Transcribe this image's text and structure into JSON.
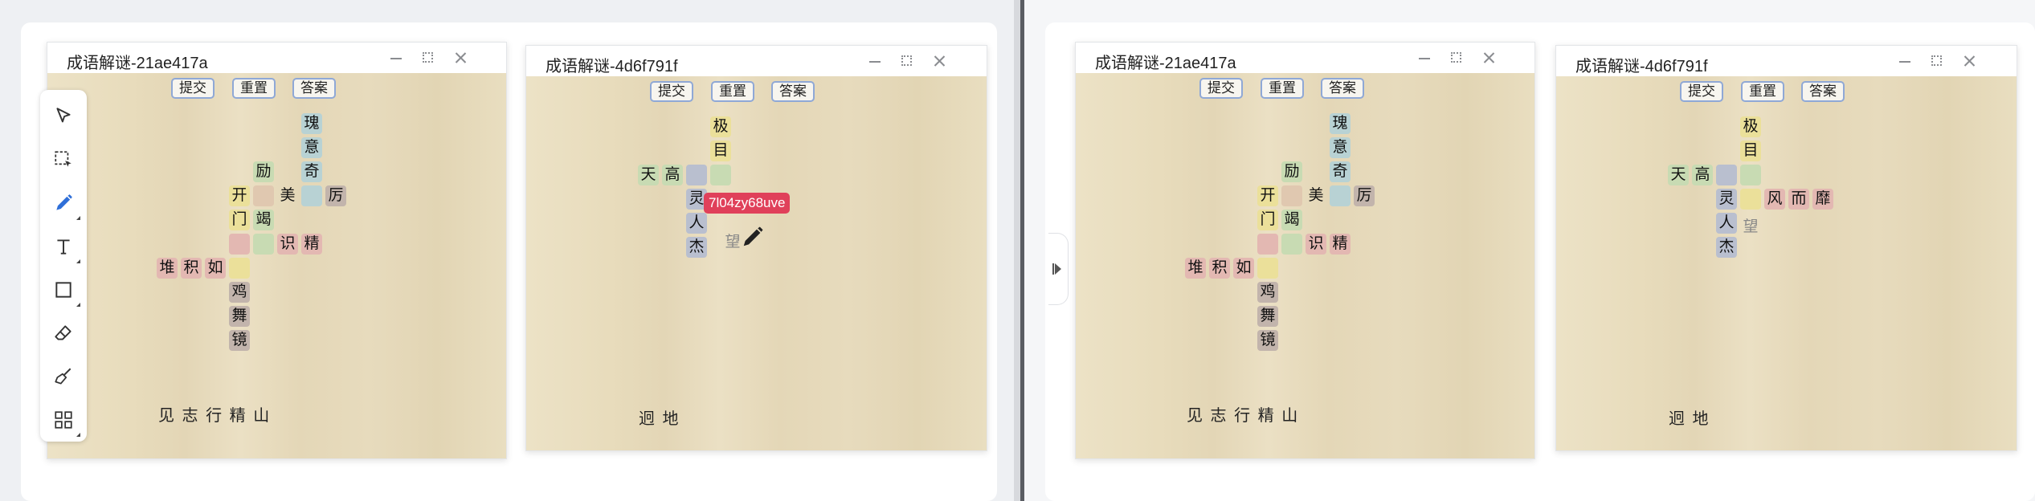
{
  "windows": [
    {
      "title": "成语解谜-21ae417a",
      "buttons": {
        "submit": "提交",
        "reset": "重置",
        "answer": "答案"
      },
      "cells": [
        "瑰",
        "意",
        "奇",
        "励",
        "开",
        "美",
        "厉",
        "门",
        "竭",
        "识",
        "精",
        "堆",
        "积",
        "如",
        "鸡",
        "舞",
        "镜"
      ],
      "bank": "见 志 行 精 山"
    },
    {
      "title": "成语解谜-4d6f791f",
      "buttons": {
        "submit": "提交",
        "reset": "重置",
        "answer": "答案"
      },
      "cells": [
        "极",
        "目",
        "天",
        "高",
        "灵",
        "人",
        "杰",
        "望"
      ],
      "bank": "迥 地",
      "drag_label": "7l04zy68uve"
    },
    {
      "title": "成语解谜-21ae417a",
      "buttons": {
        "submit": "提交",
        "reset": "重置",
        "answer": "答案"
      },
      "cells": [
        "瑰",
        "意",
        "奇",
        "励",
        "开",
        "美",
        "厉",
        "门",
        "竭",
        "识",
        "精",
        "堆",
        "积",
        "如",
        "鸡",
        "舞",
        "镜"
      ],
      "bank": "见 志 行 精 山"
    },
    {
      "title": "成语解谜-4d6f791f",
      "buttons": {
        "submit": "提交",
        "reset": "重置",
        "answer": "答案"
      },
      "cells": [
        "极",
        "目",
        "天",
        "高",
        "灵",
        "风",
        "而",
        "靡",
        "人",
        "望",
        "杰"
      ],
      "bank": "迥 地"
    }
  ],
  "toolbar": {
    "tools": [
      "select-icon",
      "marquee-select-icon",
      "pen-icon",
      "text-icon",
      "rectangle-icon",
      "eraser-icon",
      "broom-icon",
      "grid-icon"
    ]
  }
}
